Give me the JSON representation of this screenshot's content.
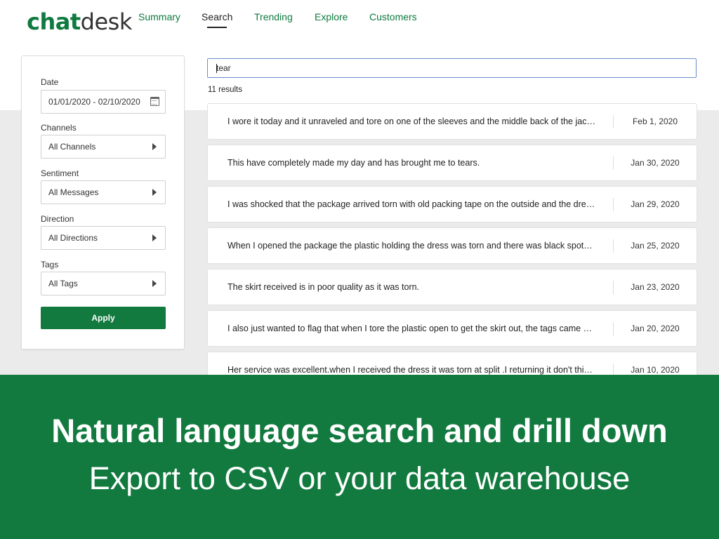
{
  "brand": {
    "logo_part1": "chat",
    "logo_part2": "desk"
  },
  "nav": {
    "items": [
      {
        "label": "Summary",
        "active": false
      },
      {
        "label": "Search",
        "active": true
      },
      {
        "label": "Trending",
        "active": false
      },
      {
        "label": "Explore",
        "active": false
      },
      {
        "label": "Customers",
        "active": false
      }
    ]
  },
  "filters": {
    "date": {
      "label": "Date",
      "value": "01/01/2020 - 02/10/2020",
      "icon": "calendar-icon"
    },
    "channels": {
      "label": "Channels",
      "value": "All Channels"
    },
    "sentiment": {
      "label": "Sentiment",
      "value": "All Messages"
    },
    "direction": {
      "label": "Direction",
      "value": "All Directions"
    },
    "tags": {
      "label": "Tags",
      "value": "All Tags"
    },
    "apply_label": "Apply"
  },
  "search": {
    "query": "tear",
    "results_count": "11 results"
  },
  "results": [
    {
      "text": "I wore it today and it unraveled and tore on one of the sleeves and the middle back of the jac…",
      "date": "Feb 1, 2020"
    },
    {
      "text": "This have completely made my day and has brought me to tears.",
      "date": "Jan 30, 2020"
    },
    {
      "text": "I was shocked that the package arrived torn with old packing tape on the outside and the dre…",
      "date": "Jan 29, 2020"
    },
    {
      "text": "When I opened the package the plastic holding the dress was torn and there was black spot…",
      "date": "Jan 25, 2020"
    },
    {
      "text": "The skirt received is in poor quality as it was torn.",
      "date": "Jan 23, 2020"
    },
    {
      "text": "I also just wanted to flag that when I tore the plastic open to get the skirt out, the tags came …",
      "date": "Jan 20, 2020"
    },
    {
      "text": "Her service was excellent.when I received the dress it was torn at split .I returning it don't thi…",
      "date": "Jan 10, 2020"
    }
  ],
  "banner": {
    "title": "Natural language search and drill down",
    "subtitle": "Export to CSV or your data warehouse"
  },
  "colors": {
    "brand_green": "#127a3f",
    "nav_green": "#0f7a40",
    "search_border": "#6c8fc8"
  }
}
